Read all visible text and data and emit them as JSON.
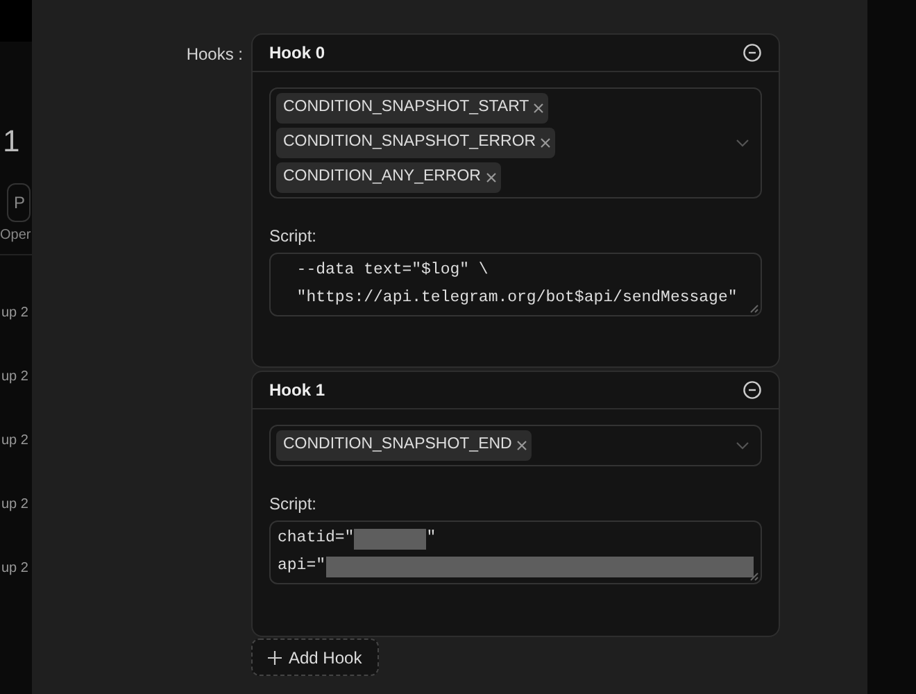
{
  "background": {
    "heading": "1",
    "button": "P",
    "column": "Oper",
    "rows": [
      "up 2",
      "up 2",
      "up 2",
      "up 2",
      "up 2"
    ]
  },
  "form": {
    "label": "Hooks :",
    "hooks": [
      {
        "title": "Hook 0",
        "conditions": [
          "CONDITION_SNAPSHOT_START",
          "CONDITION_SNAPSHOT_ERROR",
          "CONDITION_ANY_ERROR"
        ],
        "script_label": "Script:",
        "script_lines": [
          {
            "text": "  --data text=\"$log\" \\",
            "redacted": false
          },
          {
            "text": "  \"https://api.telegram.org/bot$api/sendMessage\"",
            "redacted": false
          }
        ]
      },
      {
        "title": "Hook 1",
        "conditions": [
          "CONDITION_SNAPSHOT_END"
        ],
        "script_label": "Script:",
        "script_lines": [
          {
            "text": "chatid=\"",
            "redacted": true,
            "after": "\""
          },
          {
            "text": "api=\"",
            "redacted": true
          }
        ]
      }
    ],
    "add_button": "Add Hook"
  }
}
